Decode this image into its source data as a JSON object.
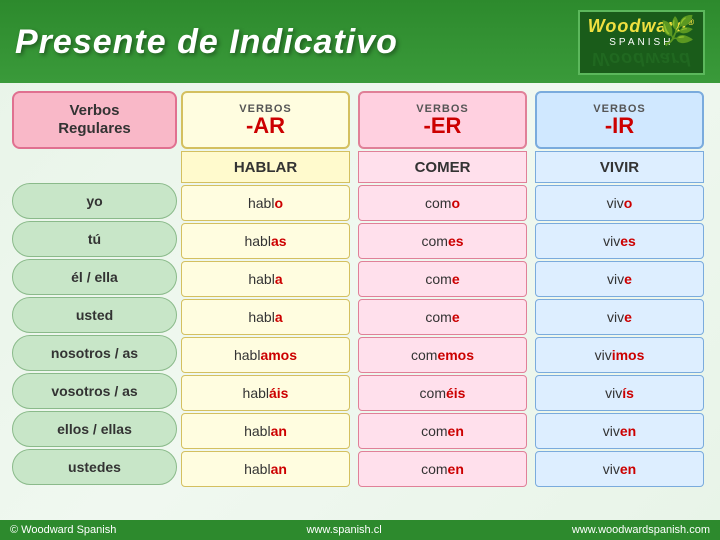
{
  "header": {
    "title": "Presente de Indicativo",
    "logo": {
      "brand": "Woodward",
      "trademark": "®",
      "language": "SPANISH"
    }
  },
  "pronouns_label": {
    "line1": "Verbos",
    "line2": "Regulares"
  },
  "columns": [
    {
      "id": "ar",
      "verbos_label": "VERBOS",
      "ending": "-AR",
      "example_verb": "HABLAR",
      "color": "yellow",
      "conjugations": [
        {
          "stem": "habl",
          "end": "o"
        },
        {
          "stem": "habl",
          "end": "as"
        },
        {
          "stem": "habl",
          "end": "a"
        },
        {
          "stem": "habl",
          "end": "a"
        },
        {
          "stem": "habl",
          "end": "amos"
        },
        {
          "stem": "habl",
          "end": "áis"
        },
        {
          "stem": "habl",
          "end": "an"
        },
        {
          "stem": "habl",
          "end": "an"
        }
      ]
    },
    {
      "id": "er",
      "verbos_label": "VERBOS",
      "ending": "-ER",
      "example_verb": "COMER",
      "color": "pink",
      "conjugations": [
        {
          "stem": "com",
          "end": "o"
        },
        {
          "stem": "com",
          "end": "es"
        },
        {
          "stem": "com",
          "end": "e"
        },
        {
          "stem": "com",
          "end": "e"
        },
        {
          "stem": "com",
          "end": "emos"
        },
        {
          "stem": "com",
          "end": "éis"
        },
        {
          "stem": "com",
          "end": "en"
        },
        {
          "stem": "com",
          "end": "en"
        }
      ]
    },
    {
      "id": "ir",
      "verbos_label": "VERBOS",
      "ending": "-IR",
      "example_verb": "VIVIR",
      "color": "blue",
      "conjugations": [
        {
          "stem": "viv",
          "end": "o"
        },
        {
          "stem": "viv",
          "end": "es"
        },
        {
          "stem": "viv",
          "end": "e"
        },
        {
          "stem": "viv",
          "end": "e"
        },
        {
          "stem": "viv",
          "end": "imos"
        },
        {
          "stem": "viv",
          "end": "ís"
        },
        {
          "stem": "viv",
          "end": "en"
        },
        {
          "stem": "viv",
          "end": "en"
        }
      ]
    }
  ],
  "pronouns": [
    "yo",
    "tú",
    "él / ella",
    "usted",
    "nosotros / as",
    "vosotros / as",
    "ellos / ellas",
    "ustedes"
  ],
  "footer": {
    "copyright": "© Woodward Spanish",
    "website1": "www.spanish.cl",
    "website2": "www.woodwardspanish.com"
  }
}
